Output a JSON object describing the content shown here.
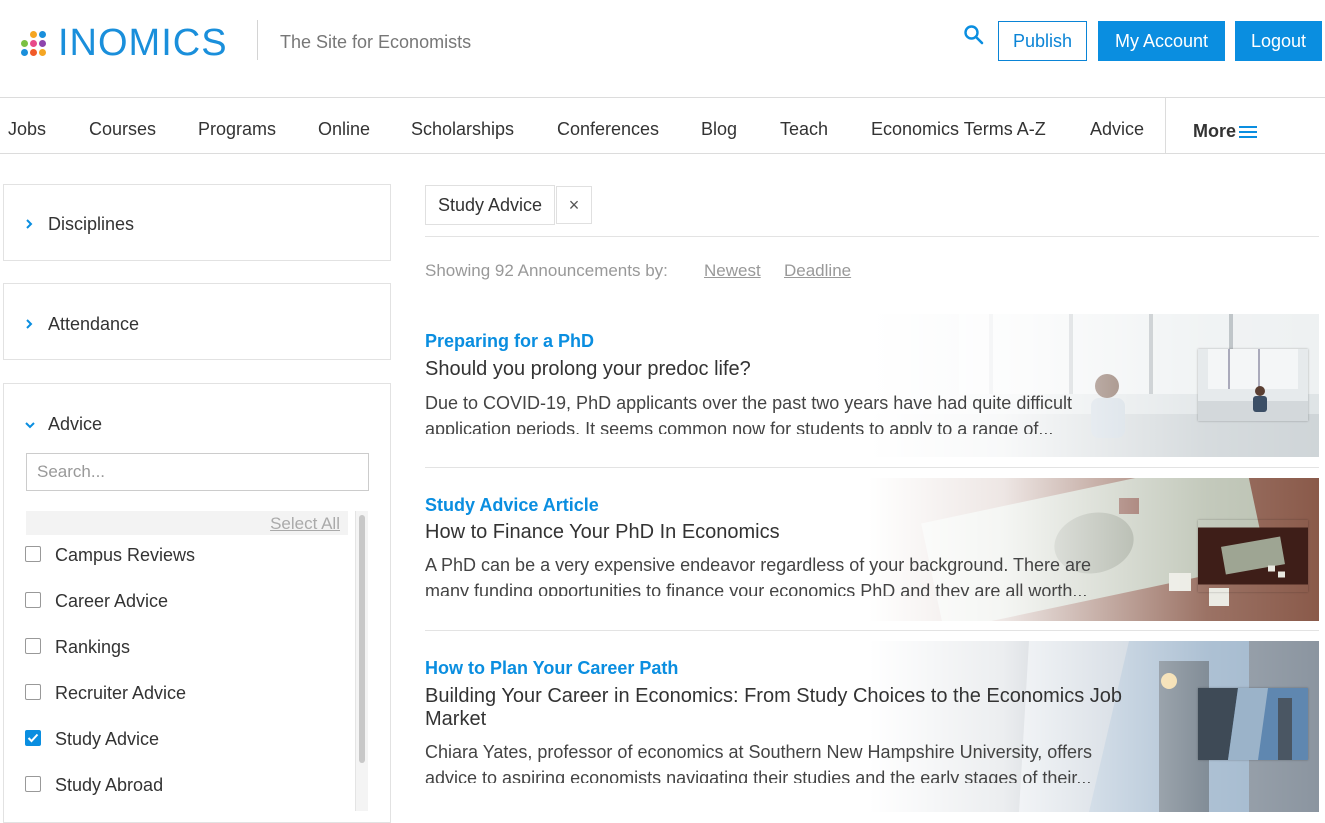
{
  "header": {
    "logo_text": "INOMICS",
    "tagline": "The Site for Economists",
    "publish_label": "Publish",
    "account_label": "My Account",
    "logout_label": "Logout",
    "logo_dot_colors": [
      "#f5a623",
      "#e84a8a",
      "#1a8fdb",
      "#7ac143",
      "#8e44ad",
      "#f15a29"
    ]
  },
  "nav": {
    "items": [
      "Jobs",
      "Courses",
      "Programs",
      "Online",
      "Scholarships",
      "Conferences",
      "Blog",
      "Teach",
      "Economics Terms A-Z",
      "Advice"
    ],
    "more_label": "More"
  },
  "sidebar": {
    "disciplines_label": "Disciplines",
    "attendance_label": "Attendance",
    "advice": {
      "label": "Advice",
      "search_placeholder": "Search...",
      "select_all_label": "Select All",
      "options": [
        {
          "label": "Campus Reviews",
          "checked": false
        },
        {
          "label": "Career Advice",
          "checked": false
        },
        {
          "label": "Rankings",
          "checked": false
        },
        {
          "label": "Recruiter Advice",
          "checked": false
        },
        {
          "label": "Study Advice",
          "checked": true
        },
        {
          "label": "Study Abroad",
          "checked": false
        }
      ]
    }
  },
  "main": {
    "active_filter": "Study Advice",
    "remove_filter_symbol": "×",
    "showing_text": "Showing 92 Announcements by:",
    "sort_newest": "Newest",
    "sort_deadline": "Deadline",
    "articles": [
      {
        "category": "Preparing for a PhD",
        "title": "Should you prolong your predoc life?",
        "description": "Due to COVID-19, PhD applicants over the past two years have had quite difficult application periods. It seems common now for students to apply to a range of...",
        "image": "office-desk-photo"
      },
      {
        "category": "Study Advice Article",
        "title": "How to Finance Your PhD In Economics",
        "description": "A PhD can be a very expensive endeavor regardless of your background. There are many funding opportunities to finance your economics PhD and they are all worth...",
        "image": "dollar-puzzle-photo"
      },
      {
        "category": "How to Plan Your Career Path",
        "title": "Building Your Career in Economics: From Study Choices to the Economics Job Market",
        "description": "Chiara Yates, professor of economics at Southern New Hampshire University, offers advice to aspiring economists navigating their studies and the early stages of their...",
        "image": "building-stairs-photo"
      }
    ]
  },
  "colors": {
    "brand_blue": "#0a8ee0",
    "checkbox_checked": "#0a8ee0"
  }
}
